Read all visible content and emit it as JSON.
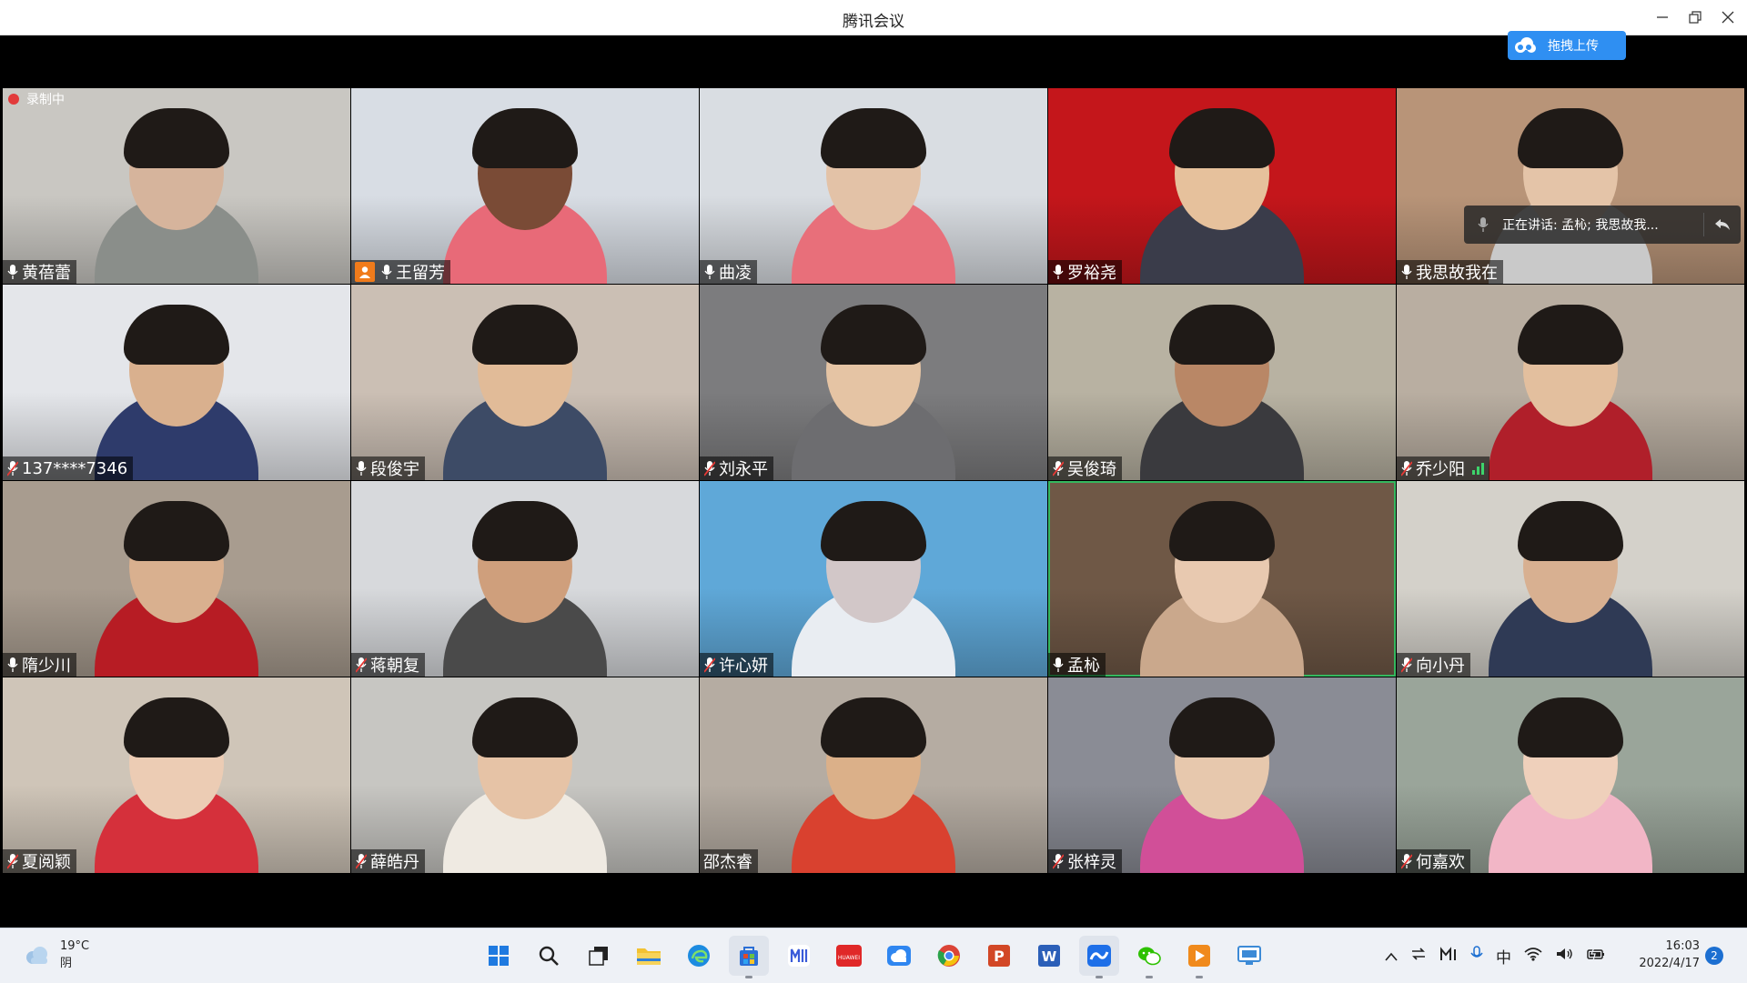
{
  "window": {
    "title": "腾讯会议",
    "upload_button_label": "拖拽上传",
    "recording_label": "录制中"
  },
  "speaker_bubble": {
    "text": "正在讲话: 孟杺; 我思故我..."
  },
  "participants": [
    {
      "name": "黄蓓蕾",
      "mic": "on",
      "bg": "#c9c7c2",
      "skin": "#d6b49c",
      "shirt": "#8a8e8a"
    },
    {
      "name": "王留芳",
      "mic": "on",
      "host": true,
      "bg": "#d8dde4",
      "skin": "#7a4b36",
      "shirt": "#e86a78"
    },
    {
      "name": "曲凌",
      "mic": "on",
      "bg": "#d9dde2",
      "skin": "#e3c2a7",
      "shirt": "#e86f7a"
    },
    {
      "name": "罗裕尧",
      "mic": "on",
      "bg": "#c4161b",
      "skin": "#e6c19c",
      "shirt": "#3a3c4a"
    },
    {
      "name": "我思故我在",
      "mic": "on",
      "bg": "#b89478",
      "skin": "#e4c4a8",
      "shirt": "#c9c9c9"
    },
    {
      "name": "137****7346",
      "mic": "muted",
      "bg": "#e4e6ea",
      "skin": "#d9b08e",
      "shirt": "#2e3b6b"
    },
    {
      "name": "段俊宇",
      "mic": "on",
      "bg": "#cbbfb4",
      "skin": "#e1bb98",
      "shirt": "#3d4b66"
    },
    {
      "name": "刘永平",
      "mic": "muted",
      "bg": "#7c7c7e",
      "skin": "#e5c4a4",
      "shirt": "#6d6d70"
    },
    {
      "name": "吴俊琦",
      "mic": "muted",
      "bg": "#b8b2a2",
      "skin": "#b98766",
      "shirt": "#3a3a3e"
    },
    {
      "name": "乔少阳",
      "mic": "muted",
      "signal": true,
      "bg": "#b9aea1",
      "skin": "#e3bf9e",
      "shirt": "#b01f2a"
    },
    {
      "name": "隋少川",
      "mic": "on",
      "bg": "#a89c8f",
      "skin": "#d9b08f",
      "shirt": "#b71c24"
    },
    {
      "name": "蒋朝复",
      "mic": "muted",
      "bg": "#d7d9dc",
      "skin": "#cf9f7c",
      "shirt": "#4a4a4a"
    },
    {
      "name": "许心妍",
      "mic": "muted",
      "bg": "#5fa8d8",
      "skin": "#d2c7c8",
      "shirt": "#e9edf2"
    },
    {
      "name": "孟杺",
      "mic": "on",
      "active": true,
      "bg": "#6f5846",
      "skin": "#e8c9b0",
      "shirt": "#caa88c"
    },
    {
      "name": "向小丹",
      "mic": "muted",
      "bg": "#d4d1ca",
      "skin": "#d8b091",
      "shirt": "#2f3a55"
    },
    {
      "name": "夏阅颖",
      "mic": "muted",
      "bg": "#cfc5b8",
      "skin": "#ecccb4",
      "shirt": "#d5303b"
    },
    {
      "name": "薛皓丹",
      "mic": "muted",
      "bg": "#c7c6c2",
      "skin": "#e6c3a6",
      "shirt": "#efeae2"
    },
    {
      "name": "邵杰睿",
      "mic": "none",
      "bg": "#b5aca2",
      "skin": "#dbb089",
      "shirt": "#d9412f"
    },
    {
      "name": "张梓灵",
      "mic": "muted",
      "bg": "#8a8c95",
      "skin": "#e7c8ad",
      "shirt": "#d14f98"
    },
    {
      "name": "何嘉欢",
      "mic": "muted",
      "bg": "#9aa59a",
      "skin": "#efd0bb",
      "shirt": "#f2b6c6"
    }
  ],
  "taskbar": {
    "weather": {
      "temp": "19°C",
      "condition": "阴"
    },
    "apps": [
      {
        "name": "start-button",
        "color": "#1f7ae0",
        "glyph": "win"
      },
      {
        "name": "search-button",
        "color": "#222",
        "glyph": "search"
      },
      {
        "name": "task-view-button",
        "color": "#222",
        "glyph": "taskview"
      },
      {
        "name": "file-explorer-app",
        "color": "#f2c232",
        "glyph": "folder"
      },
      {
        "name": "edge-app",
        "color": "#1c8be0",
        "glyph": "edge"
      },
      {
        "name": "store-app",
        "color": "#e04a2a",
        "glyph": "store",
        "running": true,
        "pressed": true
      },
      {
        "name": "notes-app",
        "color": "#3a5bd9",
        "glyph": "m"
      },
      {
        "name": "huawei-app",
        "color": "#e02828",
        "glyph": "huawei"
      },
      {
        "name": "cloud-app",
        "color": "#2f86f0",
        "glyph": "cloud"
      },
      {
        "name": "chrome-app",
        "color": "#2aa34a",
        "glyph": "chrome"
      },
      {
        "name": "powerpoint-app",
        "color": "#d24726",
        "glyph": "P"
      },
      {
        "name": "word-app",
        "color": "#2b5fb8",
        "glyph": "W"
      },
      {
        "name": "tencent-meeting-app",
        "color": "#1e6fe8",
        "glyph": "meet",
        "running": true,
        "pressed": true
      },
      {
        "name": "wechat-app",
        "color": "#2dc100",
        "glyph": "wechat",
        "running": true
      },
      {
        "name": "video-app",
        "color": "#f08a1c",
        "glyph": "video",
        "running": true
      },
      {
        "name": "screen-app",
        "color": "#3c8ad6",
        "glyph": "screen"
      }
    ],
    "tray": {
      "ime": "中"
    },
    "clock": {
      "time": "16:03",
      "date": "2022/4/17"
    },
    "notification_count": "2"
  }
}
